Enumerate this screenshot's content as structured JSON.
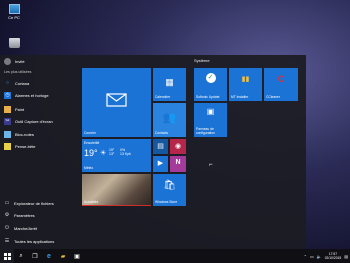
{
  "desktop": {
    "icons": [
      {
        "label": "Ce PC",
        "icon": "computer-icon"
      },
      {
        "label": "",
        "icon": "recycle-bin-icon"
      }
    ]
  },
  "start_menu": {
    "user": "Invité",
    "most_used_heading": "Les plus utilisées",
    "apps": [
      {
        "label": "Cortana",
        "icon": "cortana-icon",
        "color": "#1c73d6"
      },
      {
        "label": "Alarmes et horloge",
        "icon": "alarm-icon",
        "color": "#1c73d6"
      },
      {
        "label": "Paint",
        "icon": "paint-icon",
        "color": "#e8b04a"
      },
      {
        "label": "Outil Capture d'écran",
        "icon": "snipping-tool-icon",
        "color": "#3a3a8c"
      },
      {
        "label": "Bloc-notes",
        "icon": "notepad-icon",
        "color": "#6db4e8"
      },
      {
        "label": "Pense-bête",
        "icon": "sticky-notes-icon",
        "color": "#e8d04a"
      }
    ],
    "bottom": [
      {
        "label": "Explorateur de fichiers",
        "icon": "file-explorer-icon"
      },
      {
        "label": "Paramètres",
        "icon": "settings-gear-icon"
      },
      {
        "label": "Marche/Arrêt",
        "icon": "power-icon"
      },
      {
        "label": "Toutes les applications",
        "icon": "all-apps-icon"
      }
    ],
    "tiles_left": {
      "courrier": "Courrier",
      "calendrier": "Calendrier",
      "contacts": "Contacts",
      "weather_city": "Ensoleillé",
      "weather_temp": "19°",
      "weather_hi": "19°",
      "weather_lo": "13°",
      "weather_pct": "0%",
      "weather_wind": "13 Kph",
      "weather_title": "Météo",
      "actualites": "Actualités",
      "store": "Windows Store"
    },
    "group_right_title": "Système",
    "tiles_right": [
      {
        "label": "Softonic Update"
      },
      {
        "label": "MT Installer"
      },
      {
        "label": "CCleaner"
      },
      {
        "label": "Panneau de configuration"
      }
    ]
  },
  "taskbar": {
    "time": "17:57",
    "date": "02/10/2015"
  }
}
